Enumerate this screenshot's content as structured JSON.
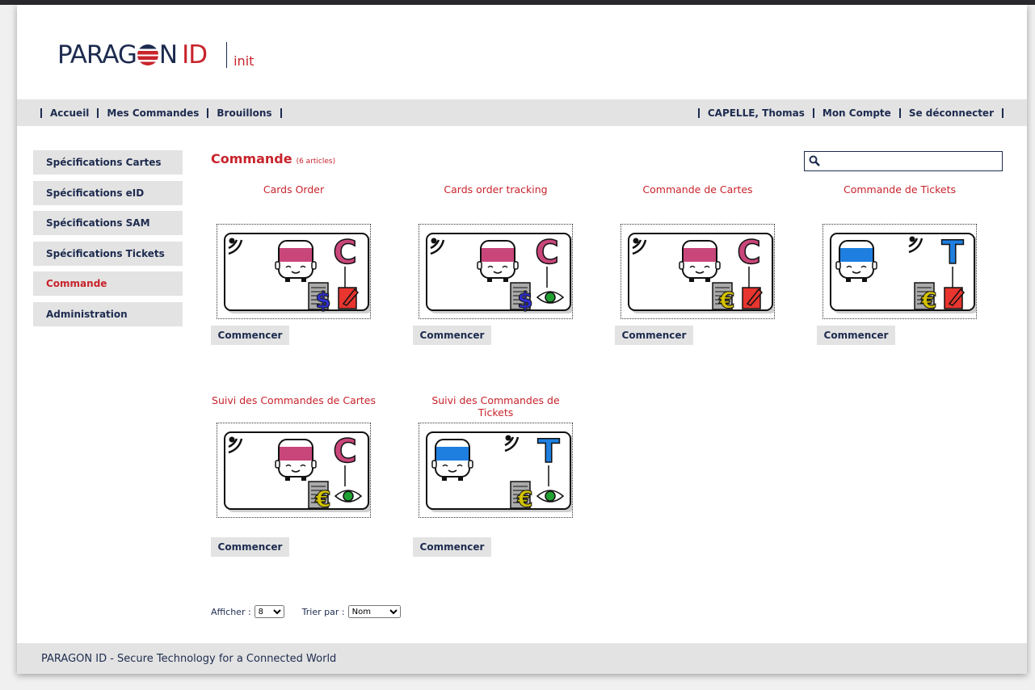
{
  "header": {
    "logo_text": "PARAGON ID",
    "logo_sub": "init"
  },
  "nav": {
    "left": [
      "Accueil",
      "Mes Commandes",
      "Brouillons"
    ],
    "right": [
      "CAPELLE, Thomas",
      "Mon Compte",
      "Se déconnecter"
    ]
  },
  "sidebar": {
    "items": [
      {
        "label": "Spécifications Cartes"
      },
      {
        "label": "Spécifications eID"
      },
      {
        "label": "Spécifications SAM"
      },
      {
        "label": "Spécifications Tickets"
      },
      {
        "label": "Commande",
        "active": true
      },
      {
        "label": "Administration"
      }
    ]
  },
  "main": {
    "title": "Commande",
    "count": "(6 articles)",
    "search": {
      "value": "",
      "placeholder": ""
    },
    "products": [
      {
        "name": "Cards Order",
        "button": "Commencer",
        "letter": "C",
        "currency": "$",
        "action": "edit",
        "color": "#c8467a"
      },
      {
        "name": "Cards order tracking",
        "button": "Commencer",
        "letter": "C",
        "currency": "$",
        "action": "view",
        "color": "#c8467a"
      },
      {
        "name": "Commande de Cartes",
        "button": "Commencer",
        "letter": "C",
        "currency": "€",
        "action": "edit",
        "color": "#c8467a"
      },
      {
        "name": "Commande de Tickets",
        "button": "Commencer",
        "letter": "T",
        "currency": "€",
        "action": "edit",
        "color": "#1e7fe0"
      },
      {
        "name": "Suivi des Commandes de Cartes",
        "button": "Commencer",
        "letter": "C",
        "currency": "€",
        "action": "view",
        "color": "#c8467a"
      },
      {
        "name": "Suivi des Commandes de Tickets",
        "button": "Commencer",
        "letter": "T",
        "currency": "€",
        "action": "view",
        "color": "#1e7fe0"
      }
    ],
    "show_label": "Afficher :",
    "show_value": "8",
    "sort_label": "Trier par :",
    "sort_value": "Nom"
  },
  "footer": {
    "text": "PARAGON ID - Secure Technology for a Connected World"
  }
}
